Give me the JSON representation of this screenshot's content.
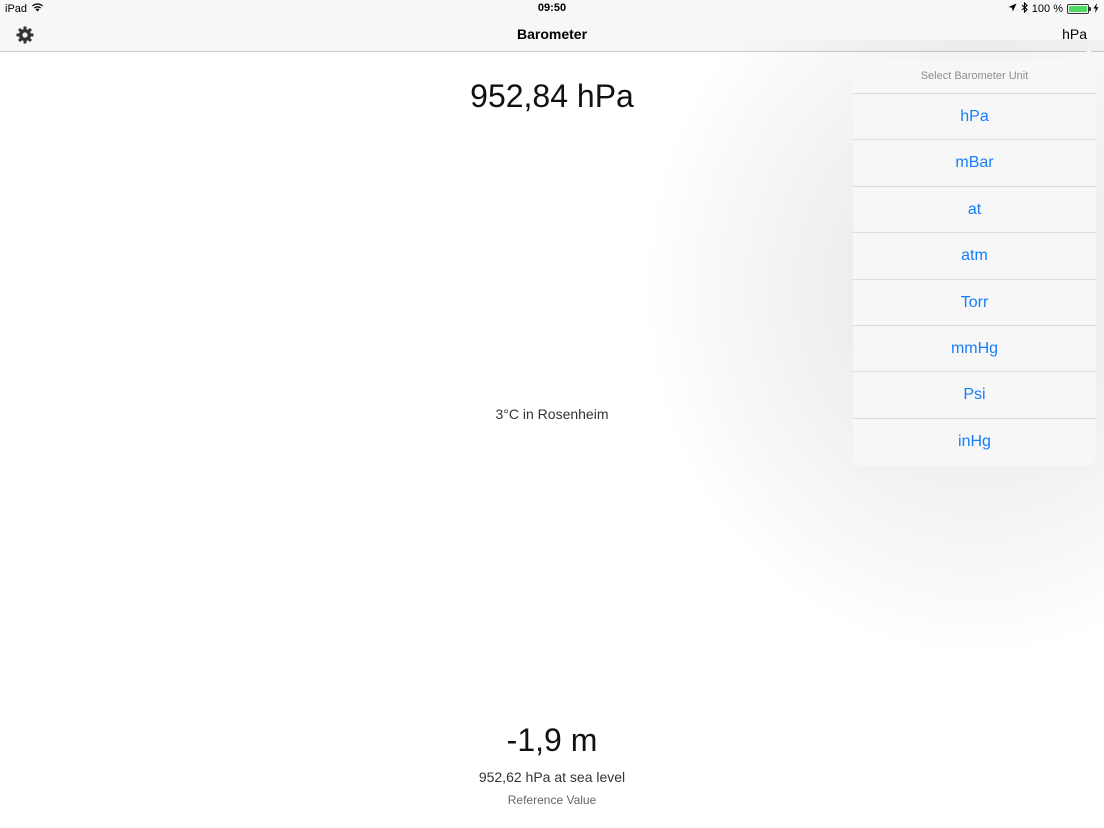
{
  "status_bar": {
    "device": "iPad",
    "time": "09:50",
    "battery_percent": "100 %",
    "battery_level": 1.0,
    "icons": [
      "wifi-icon",
      "location-arrow-icon",
      "bluetooth-icon",
      "battery-icon",
      "charging-bolt-icon"
    ]
  },
  "nav": {
    "title": "Barometer",
    "unit_button": "hPa",
    "settings_icon": "gear-icon"
  },
  "main": {
    "pressure": "952,84 hPa",
    "weather": "3°C in Rosenheim",
    "altitude": "-1,9 m",
    "sea_level": "952,62 hPa at sea level",
    "reference_label": "Reference Value"
  },
  "popover": {
    "header": "Select Barometer Unit",
    "options": [
      "hPa",
      "mBar",
      "at",
      "atm",
      "Torr",
      "mmHg",
      "Psi",
      "inHg"
    ]
  },
  "colors": {
    "accent": "#157efb",
    "bar_background": "#f7f7f7",
    "battery_green": "#4cd964"
  }
}
